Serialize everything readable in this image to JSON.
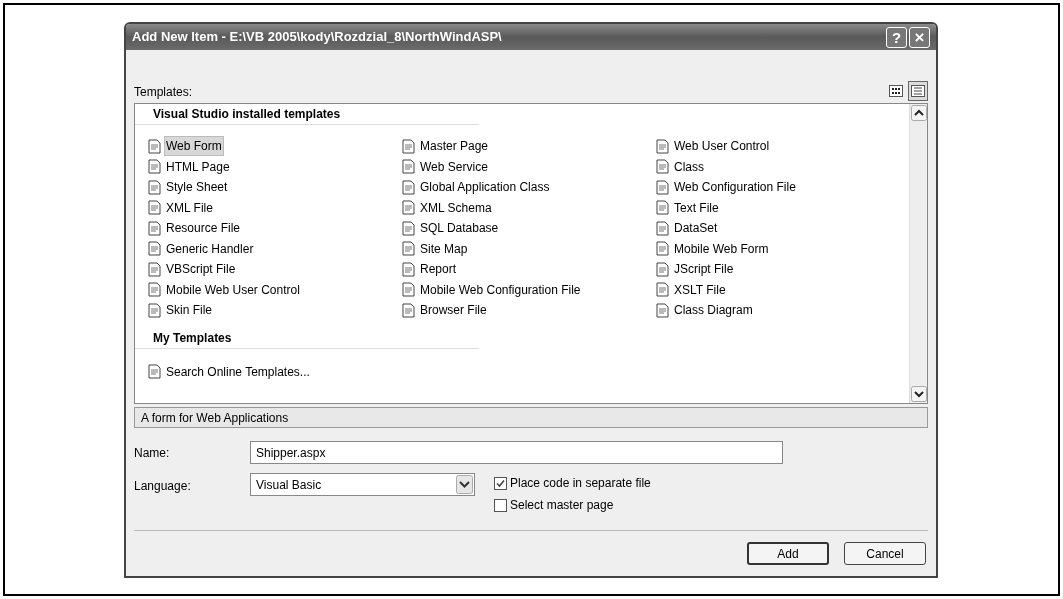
{
  "window": {
    "title": "Add New Item - E:\\VB 2005\\kody\\Rozdzial_8\\NorthWindASP\\",
    "help": "?",
    "close": "×"
  },
  "templates_label": "Templates:",
  "view_buttons": [
    {
      "kind": "large",
      "selected": false
    },
    {
      "kind": "small",
      "selected": true
    }
  ],
  "groups": [
    {
      "title": "Visual Studio installed templates",
      "items": [
        {
          "label": "Web Form",
          "selected": true
        },
        {
          "label": "Master Page",
          "selected": false
        },
        {
          "label": "Web User Control",
          "selected": false
        },
        {
          "label": "HTML Page",
          "selected": false
        },
        {
          "label": "Web Service",
          "selected": false
        },
        {
          "label": "Class",
          "selected": false
        },
        {
          "label": "Style Sheet",
          "selected": false
        },
        {
          "label": "Global Application Class",
          "selected": false
        },
        {
          "label": "Web Configuration File",
          "selected": false
        },
        {
          "label": "XML File",
          "selected": false
        },
        {
          "label": "XML Schema",
          "selected": false
        },
        {
          "label": "Text File",
          "selected": false
        },
        {
          "label": "Resource File",
          "selected": false
        },
        {
          "label": "SQL Database",
          "selected": false
        },
        {
          "label": "DataSet",
          "selected": false
        },
        {
          "label": "Generic Handler",
          "selected": false
        },
        {
          "label": "Site Map",
          "selected": false
        },
        {
          "label": "Mobile Web Form",
          "selected": false
        },
        {
          "label": "VBScript File",
          "selected": false
        },
        {
          "label": "Report",
          "selected": false
        },
        {
          "label": "JScript File",
          "selected": false
        },
        {
          "label": "Mobile Web User Control",
          "selected": false
        },
        {
          "label": "Mobile Web Configuration File",
          "selected": false
        },
        {
          "label": "XSLT File",
          "selected": false
        },
        {
          "label": "Skin File",
          "selected": false
        },
        {
          "label": "Browser File",
          "selected": false
        },
        {
          "label": "Class Diagram",
          "selected": false
        }
      ]
    },
    {
      "title": "My Templates",
      "items": [
        {
          "label": "Search Online Templates...",
          "selected": false
        }
      ]
    }
  ],
  "description": "A form for Web Applications",
  "name_field": {
    "label": "Name:",
    "value": "Shipper.aspx"
  },
  "language_field": {
    "label": "Language:",
    "value": "Visual Basic"
  },
  "options": [
    {
      "label": "Place code in separate file",
      "checked": true
    },
    {
      "label": "Select master page",
      "checked": false
    }
  ],
  "buttons": [
    {
      "label": "Add",
      "default": true
    },
    {
      "label": "Cancel",
      "default": false
    }
  ]
}
